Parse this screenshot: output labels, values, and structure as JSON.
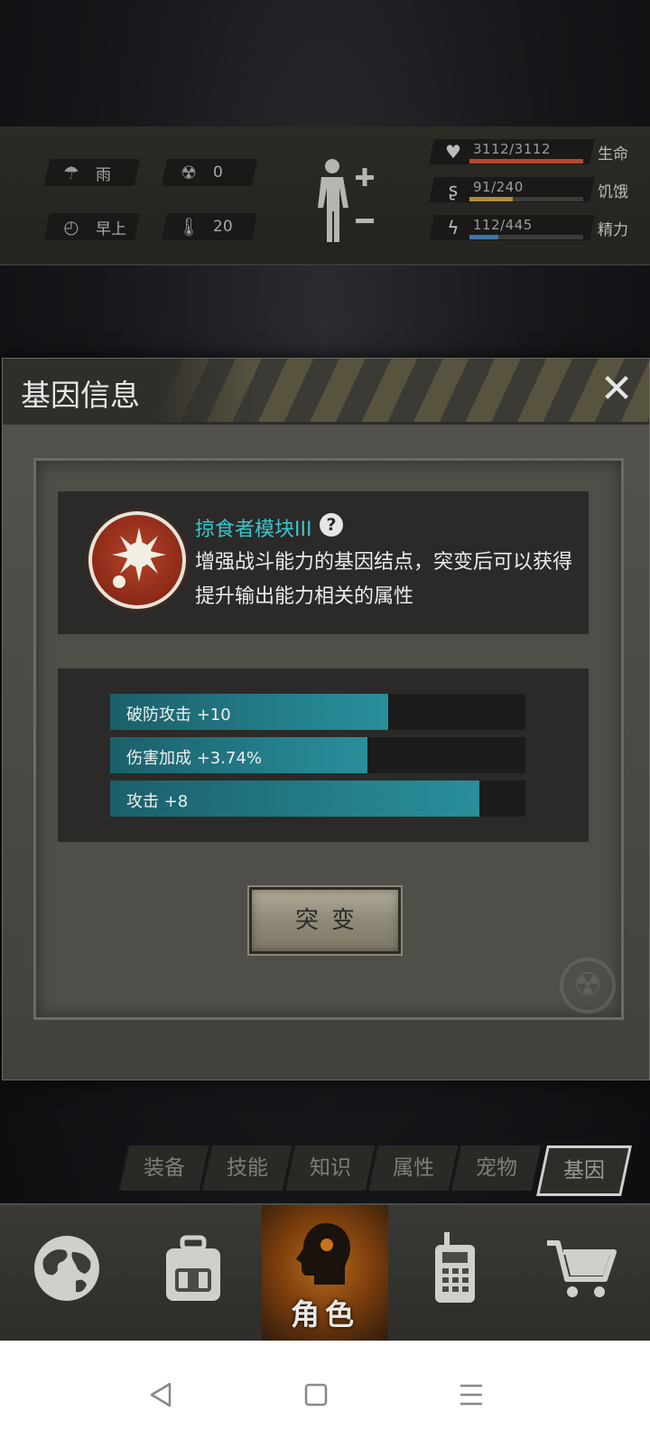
{
  "status": {
    "weather": "雨",
    "radiation": "0",
    "time_of_day": "早上",
    "temperature": "20",
    "icons": [
      "rain-cloud-icon",
      "radiation-icon",
      "clock-icon",
      "thermometer-icon"
    ]
  },
  "vitals": [
    {
      "value": "3112/3112",
      "name": "生命",
      "fill_fraction": 1.0,
      "color": "#b34a2e",
      "icon": "heart-icon"
    },
    {
      "value": "91/240",
      "name": "饥饿",
      "fill_fraction": 0.38,
      "color": "#b28a3a",
      "icon": "stomach-icon"
    },
    {
      "value": "112/445",
      "name": "精力",
      "fill_fraction": 0.25,
      "color": "#3a78b2",
      "icon": "energy-icon"
    }
  ],
  "dialog": {
    "title": "基因信息",
    "close_symbol": "✕",
    "gene_name": "掠食者模块III",
    "help_symbol": "?",
    "description": "增强战斗能力的基因结点，突变后可以获得提升输出能力相关的属性",
    "attributes": [
      {
        "label": "破防攻击 +10",
        "fill_fraction": 0.67
      },
      {
        "label": "伤害加成 +3.74%",
        "fill_fraction": 0.62
      },
      {
        "label": "攻击 +8",
        "fill_fraction": 0.89
      }
    ],
    "mutate_label": "突变"
  },
  "subtabs": [
    "装备",
    "技能",
    "知识",
    "属性",
    "宠物",
    "基因"
  ],
  "active_subtab": "基因",
  "nav": {
    "items": [
      "globe-icon",
      "backpack-icon",
      "character-icon",
      "radio-icon",
      "cart-icon"
    ],
    "active_label": "角色"
  },
  "colors": {
    "accent_teal": "#39c6cc",
    "bar_teal": "#24828e",
    "active_nav": "#b86a1a"
  }
}
